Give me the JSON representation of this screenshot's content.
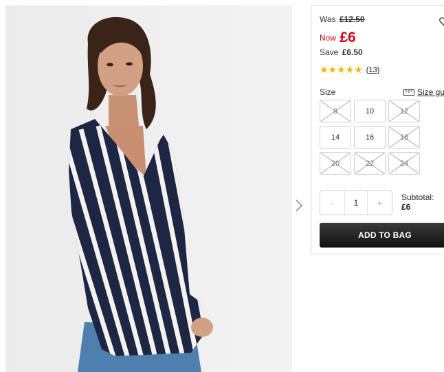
{
  "product": {
    "image_alt": "Striped long sleeve blouse",
    "icons": {
      "next": "chevron-right-icon",
      "wishlist": "heart-icon",
      "size_guide": "ruler-icon"
    }
  },
  "pricing": {
    "was_label": "Was",
    "was_price": "£12.50",
    "now_label": "Now",
    "now_price": "£6",
    "save_label": "Save",
    "save_amount": "£6.50",
    "accent_color": "#d0021b"
  },
  "rating": {
    "stars": 5,
    "stars_text": "★★★★★",
    "count": "(13)",
    "star_color": "#f5b301"
  },
  "size": {
    "label": "Size",
    "guide_label": "Size guide",
    "options": [
      {
        "label": "8",
        "available": false
      },
      {
        "label": "10",
        "available": true
      },
      {
        "label": "12",
        "available": false
      },
      {
        "label": "14",
        "available": true
      },
      {
        "label": "16",
        "available": true
      },
      {
        "label": "18",
        "available": false
      },
      {
        "label": "20",
        "available": false
      },
      {
        "label": "22",
        "available": false
      },
      {
        "label": "24",
        "available": false
      }
    ]
  },
  "quantity": {
    "minus": "-",
    "value": "1",
    "plus": "+"
  },
  "subtotal": {
    "label": "Subtotal:",
    "value": "£6"
  },
  "cta": {
    "add_to_bag": "ADD TO BAG"
  }
}
